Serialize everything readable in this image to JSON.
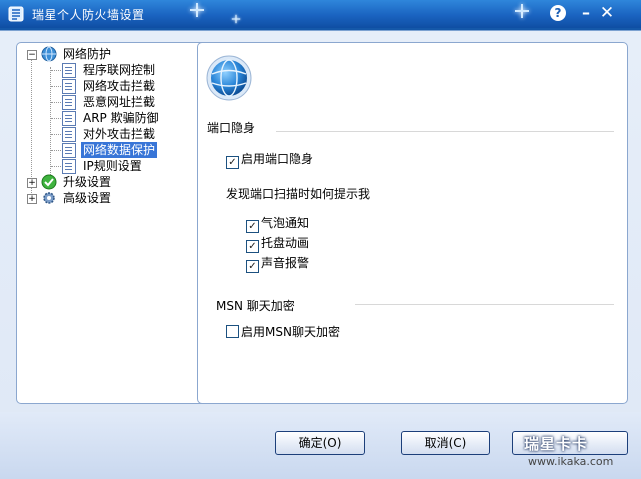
{
  "window": {
    "title": "瑞星个人防火墙设置",
    "help_label": "?",
    "minimize_label": "–",
    "close_label": "✕"
  },
  "tree": {
    "root_network": "网络防护",
    "items": [
      "程序联网控制",
      "网络攻击拦截",
      "恶意网址拦截",
      "ARP 欺骗防御",
      "对外攻击拦截",
      "网络数据保护",
      "IP规则设置"
    ],
    "selected_index": 5,
    "upgrade": "升级设置",
    "advanced": "高级设置"
  },
  "panel": {
    "port_stealth_title": "端口隐身",
    "enable_port_stealth": {
      "label": "启用端口隐身",
      "checked": true
    },
    "scan_prompt_title": "发现端口扫描时如何提示我",
    "bubble": {
      "label": "气泡通知",
      "checked": true
    },
    "tray_anim": {
      "label": "托盘动画",
      "checked": true
    },
    "sound_alert": {
      "label": "声音报警",
      "checked": true
    },
    "msn_title": "MSN 聊天加密",
    "enable_msn": {
      "label": "启用MSN聊天加密",
      "checked": false
    }
  },
  "buttons": {
    "ok": "确定(O)",
    "cancel": "取消(C)"
  },
  "watermark": {
    "logo": "瑞星卡卡",
    "url": "www.ikaka.com"
  }
}
